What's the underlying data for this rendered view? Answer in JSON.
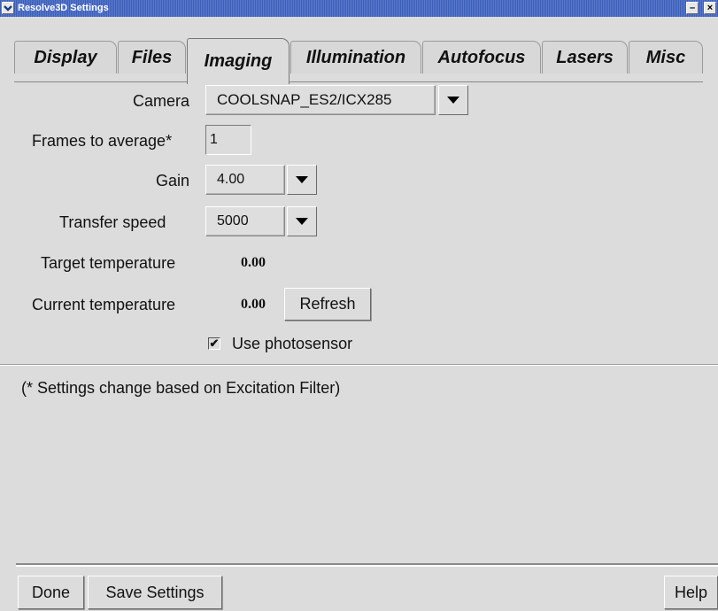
{
  "window": {
    "title": "Resolve3D Settings",
    "minimize_glyph": "–",
    "close_glyph": "×"
  },
  "tabs": [
    {
      "label": "Display",
      "active": false
    },
    {
      "label": "Files",
      "active": false
    },
    {
      "label": "Imaging",
      "active": true
    },
    {
      "label": "Illumination",
      "active": false
    },
    {
      "label": "Autofocus",
      "active": false
    },
    {
      "label": "Lasers",
      "active": false
    },
    {
      "label": "Misc",
      "active": false
    }
  ],
  "imaging": {
    "camera_label": "Camera",
    "camera_value": "COOLSNAP_ES2/ICX285",
    "frames_label": "Frames to average*",
    "frames_value": "1",
    "gain_label": "Gain",
    "gain_value": "4.00",
    "transfer_label": "Transfer speed",
    "transfer_value": "5000",
    "target_temp_label": "Target temperature",
    "target_temp_value": "0.00",
    "current_temp_label": "Current temperature",
    "current_temp_value": "0.00",
    "refresh_label": "Refresh",
    "photosensor_label": "Use photosensor",
    "photosensor_checked": true,
    "check_glyph": "✔"
  },
  "note": "(* Settings change based on Excitation Filter)",
  "footer": {
    "done_label": "Done",
    "save_label": "Save Settings",
    "help_label": "Help"
  }
}
